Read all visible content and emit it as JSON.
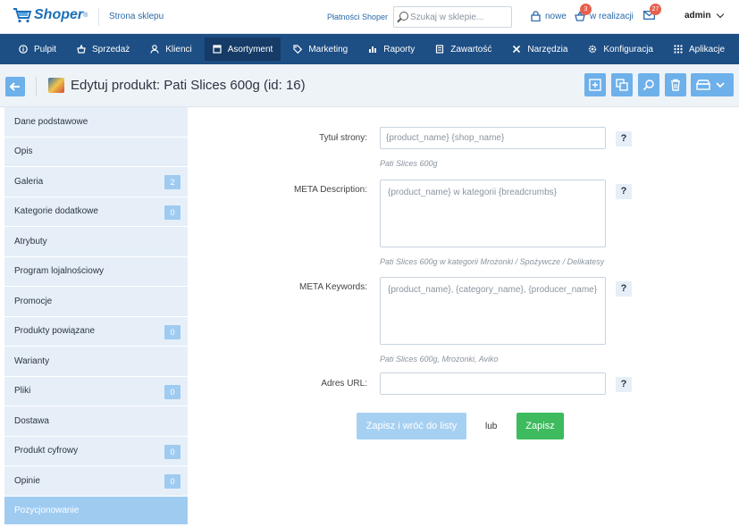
{
  "header": {
    "logo": "Shoper",
    "logo_mark": "®",
    "store_link": "Strona sklepu",
    "payments_link": "Płatności Shoper",
    "search_placeholder": "Szukaj w sklepie...",
    "new_label": "nowe",
    "in_progress_count": "3",
    "in_progress_label": "w realizacji",
    "messages_count": "27",
    "user": "admin"
  },
  "nav": {
    "items": [
      {
        "label": "Pulpit",
        "icon": "info-icon"
      },
      {
        "label": "Sprzedaż",
        "icon": "cart-icon"
      },
      {
        "label": "Klienci",
        "icon": "user-icon"
      },
      {
        "label": "Asortyment",
        "icon": "box-icon",
        "active": true
      },
      {
        "label": "Marketing",
        "icon": "tag-icon"
      },
      {
        "label": "Raporty",
        "icon": "chart-icon"
      },
      {
        "label": "Zawartość",
        "icon": "document-icon"
      },
      {
        "label": "Narzędzia",
        "icon": "tools-icon"
      },
      {
        "label": "Konfiguracja",
        "icon": "gear-icon"
      },
      {
        "label": "Aplikacje",
        "icon": "grid-icon"
      }
    ]
  },
  "title": "Edytuj produkt: Pati Slices 600g (id: 16)",
  "sidebar": {
    "items": [
      {
        "label": "Dane podstawowe",
        "badge": null
      },
      {
        "label": "Opis",
        "badge": null
      },
      {
        "label": "Galeria",
        "badge": "2"
      },
      {
        "label": "Kategorie dodatkowe",
        "badge": "0"
      },
      {
        "label": "Atrybuty",
        "badge": null
      },
      {
        "label": "Program lojalnościowy",
        "badge": null
      },
      {
        "label": "Promocje",
        "badge": null
      },
      {
        "label": "Produkty powiązane",
        "badge": "0"
      },
      {
        "label": "Warianty",
        "badge": null
      },
      {
        "label": "Pliki",
        "badge": "0"
      },
      {
        "label": "Dostawa",
        "badge": null
      },
      {
        "label": "Produkt cyfrowy",
        "badge": "0"
      },
      {
        "label": "Opinie",
        "badge": "0"
      },
      {
        "label": "Pozycjonowanie",
        "badge": null,
        "active": true
      }
    ]
  },
  "form": {
    "page_title": {
      "label": "Tytuł strony:",
      "value": "",
      "placeholder": "{product_name} {shop_name}",
      "hint": "Pati Slices 600g"
    },
    "meta_description": {
      "label": "META Description:",
      "value": "",
      "placeholder": "{product_name} w kategorii {breadcrumbs}",
      "hint": "Pati Slices 600g w kategorii Mrożonki / Spożywcze / Delikatesy"
    },
    "meta_keywords": {
      "label": "META Keywords:",
      "value": "",
      "placeholder": "{product_name}, {category_name}, {producer_name}",
      "hint": "Pati Slices 600g, Mrożonki, Aviko"
    },
    "url": {
      "label": "Adres URL:",
      "value": "",
      "placeholder": ""
    },
    "help": "?",
    "save_back_label": "Zapisz i wróć do listy",
    "or_label": "lub",
    "save_label": "Zapisz"
  },
  "colors": {
    "nav_bg": "#1d4e84",
    "nav_active": "#153b66",
    "accent_light": "#6db0ea",
    "sidebar_bg": "#e6eff8",
    "sidebar_active": "#9fcbf1",
    "save_green": "#3dbb5e"
  }
}
